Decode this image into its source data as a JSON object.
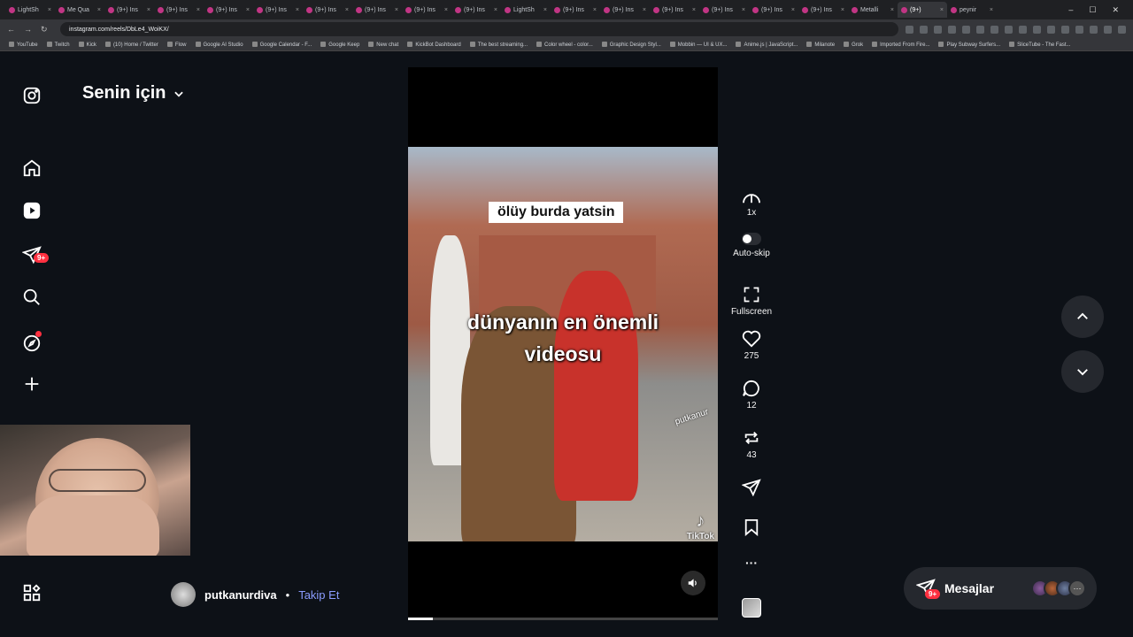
{
  "browser": {
    "tabs": [
      "LightSh",
      "Me Qua",
      "(9+) Ins",
      "(9+) Ins",
      "(9+) Ins",
      "(9+) Ins",
      "(9+) Ins",
      "(9+) Ins",
      "(9+) Ins",
      "(9+) Ins",
      "LightSh",
      "(9+) Ins",
      "(9+) Ins",
      "(9+) Ins",
      "(9+) Ins",
      "(9+) Ins",
      "(9+) Ins",
      "Metalli",
      "(9+)",
      "peynir"
    ],
    "url": "instagram.com/reels/DbLe4_WoiKX/",
    "bookmarks": [
      "YouTube",
      "Twitch",
      "Kick",
      "(10) Home / Twitter",
      "Flow",
      "Google AI Studio",
      "Google Calendar - F...",
      "Google Keep",
      "New chat",
      "KickBot Dashboard",
      "The best streaming...",
      "Color wheel - color...",
      "Graphic Design Styl...",
      "Mobbin — UI & UX...",
      "Anime.js | JavaScript...",
      "Milanote",
      "Grok",
      "Imported From Fire...",
      "Play Subway Surfers...",
      "SliceTube - The Fast..."
    ]
  },
  "header": {
    "title": "Senin için"
  },
  "sidebar": {
    "notifications_badge": "9+"
  },
  "video": {
    "caption_top": "ölüy burda yatsin",
    "caption_main_line1": "dünyanın en önemli",
    "caption_main_line2": "videosu",
    "watermark": "putkanur",
    "tiktok_label": "TikTok",
    "progress_fraction": 0.08
  },
  "actions": {
    "speed": "1x",
    "autoskip": "Auto-skip",
    "fullscreen": "Fullscreen",
    "likes": "275",
    "comments": "12",
    "reposts": "43",
    "more": "···"
  },
  "author": {
    "name": "putkanurdiva",
    "separator": "•",
    "follow": "Takip Et"
  },
  "messages": {
    "label": "Mesajlar",
    "badge": "9+",
    "more": "···"
  },
  "colors": {
    "background": "#0d1117",
    "follow_link": "#8b9cff",
    "badge": "#ff3040"
  }
}
